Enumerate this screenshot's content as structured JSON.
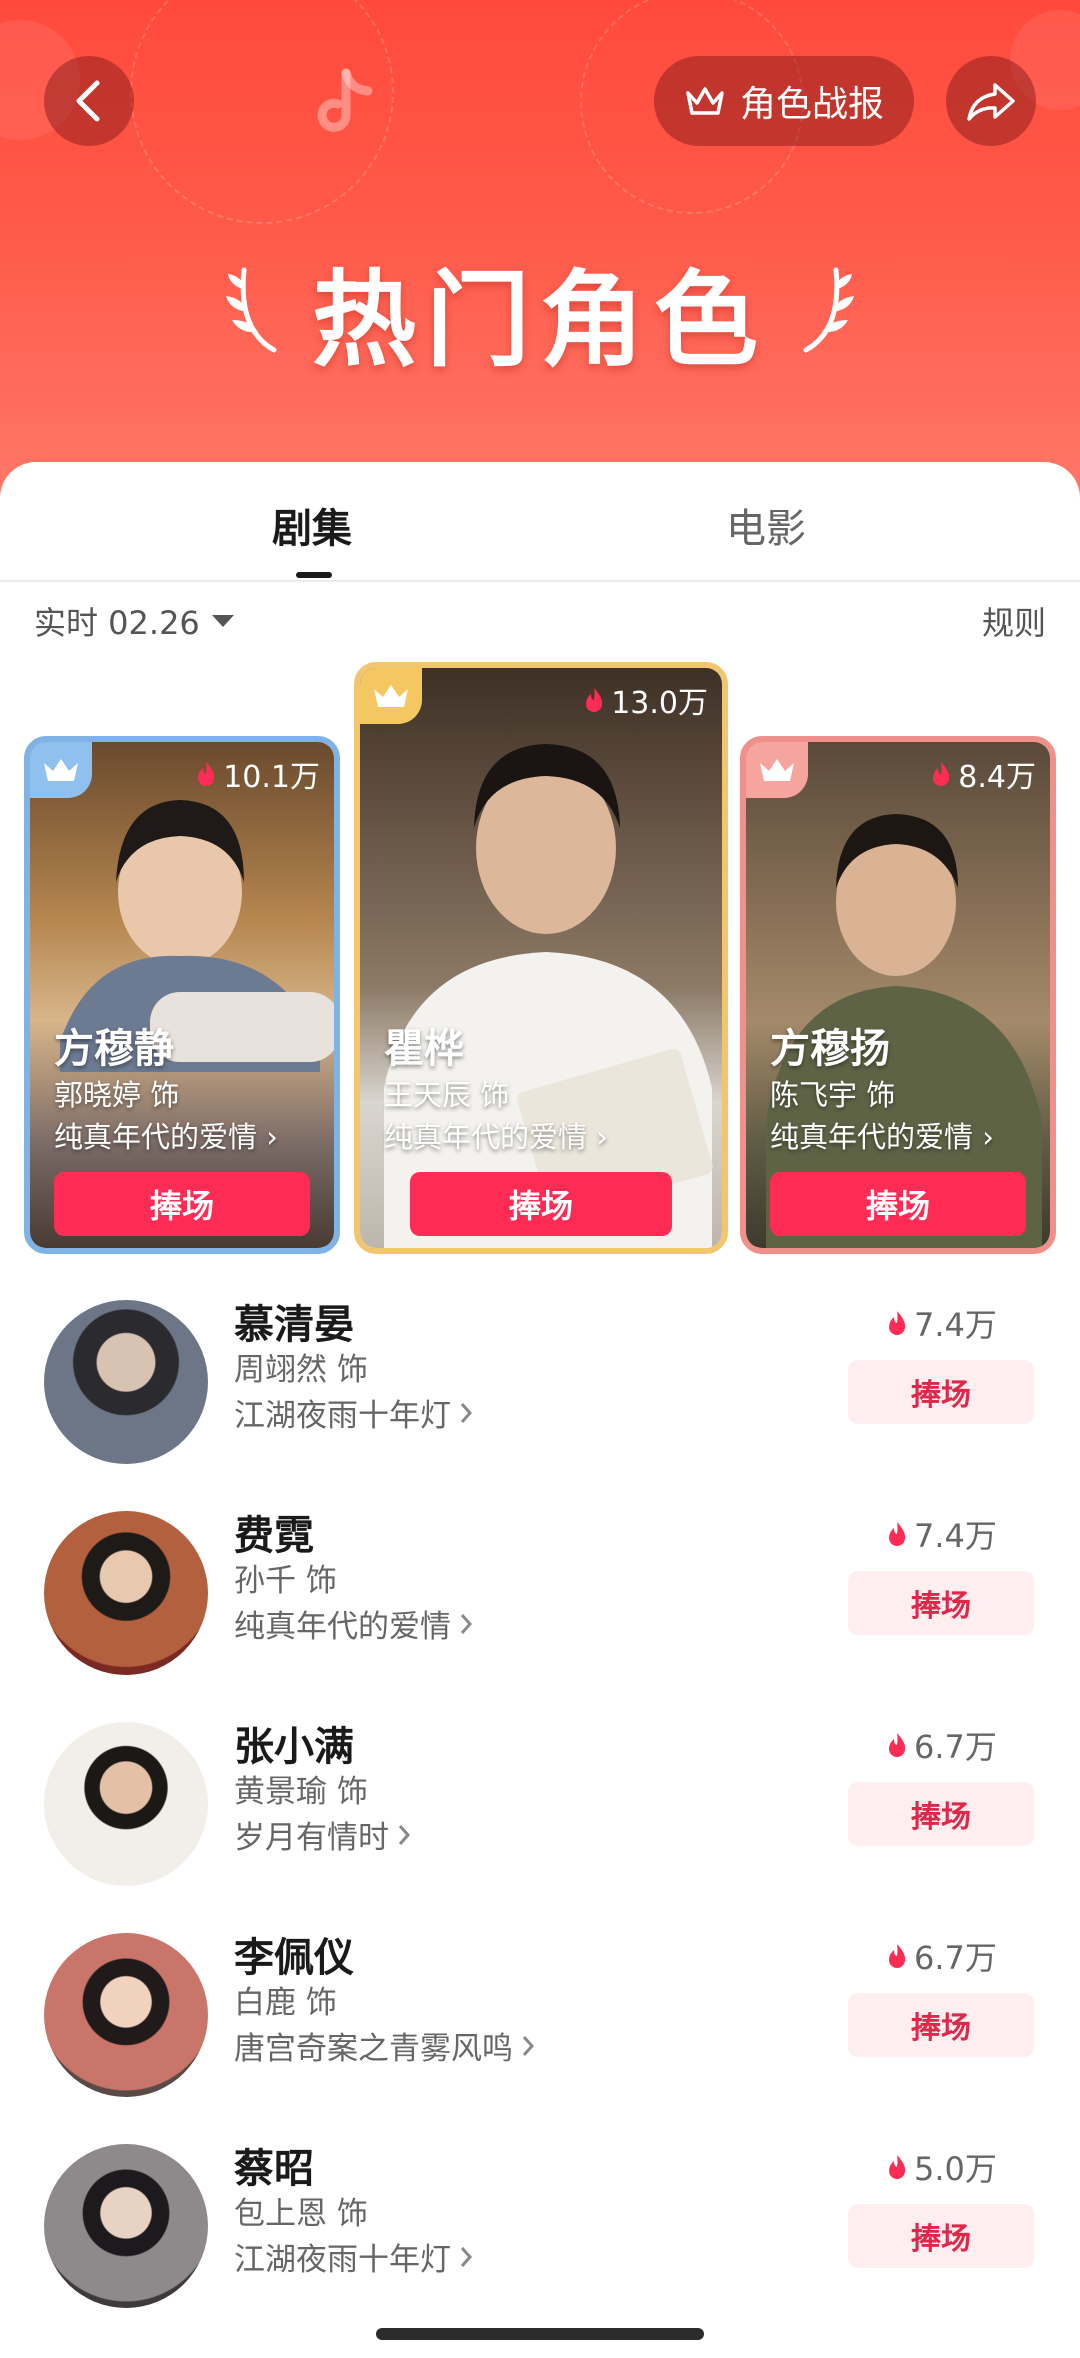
{
  "header": {
    "report_label": "角色战报",
    "title": "热门角色"
  },
  "tabs": [
    {
      "label": "剧集",
      "active": true
    },
    {
      "label": "电影",
      "active": false
    }
  ],
  "filter": {
    "realtime_label": "实时 02.26",
    "rules_label": "规则"
  },
  "top3": [
    {
      "rank": 2,
      "heat": "10.1万",
      "name": "方穆静",
      "actor": "郭晓婷  饰",
      "drama": "纯真年代的爱情 ›",
      "button": "捧场",
      "frame_color": "#7fb3e6"
    },
    {
      "rank": 1,
      "heat": "13.0万",
      "name": "瞿桦",
      "actor": "王天辰  饰",
      "drama": "纯真年代的爱情 ›",
      "button": "捧场",
      "frame_color": "#f1c66e"
    },
    {
      "rank": 3,
      "heat": "8.4万",
      "name": "方穆扬",
      "actor": "陈飞宇  饰",
      "drama": "纯真年代的爱情 ›",
      "button": "捧场",
      "frame_color": "#f0908a"
    }
  ],
  "list": [
    {
      "name": "慕清晏",
      "actor": "周翊然  饰",
      "drama": "江湖夜雨十年灯",
      "heat": "7.4万",
      "button": "捧场"
    },
    {
      "name": "费霓",
      "actor": "孙千  饰",
      "drama": "纯真年代的爱情",
      "heat": "7.4万",
      "button": "捧场"
    },
    {
      "name": "张小满",
      "actor": "黄景瑜  饰",
      "drama": "岁月有情时",
      "heat": "6.7万",
      "button": "捧场"
    },
    {
      "name": "李佩仪",
      "actor": "白鹿  饰",
      "drama": "唐宫奇案之青雾风鸣",
      "heat": "6.7万",
      "button": "捧场"
    },
    {
      "name": "蔡昭",
      "actor": "包上恩  饰",
      "drama": "江湖夜雨十年灯",
      "heat": "5.0万",
      "button": "捧场"
    }
  ],
  "colors": {
    "header_red": "#ff4a3c",
    "accent": "#fe2c55",
    "cheer_light_bg": "#ffeef0"
  }
}
